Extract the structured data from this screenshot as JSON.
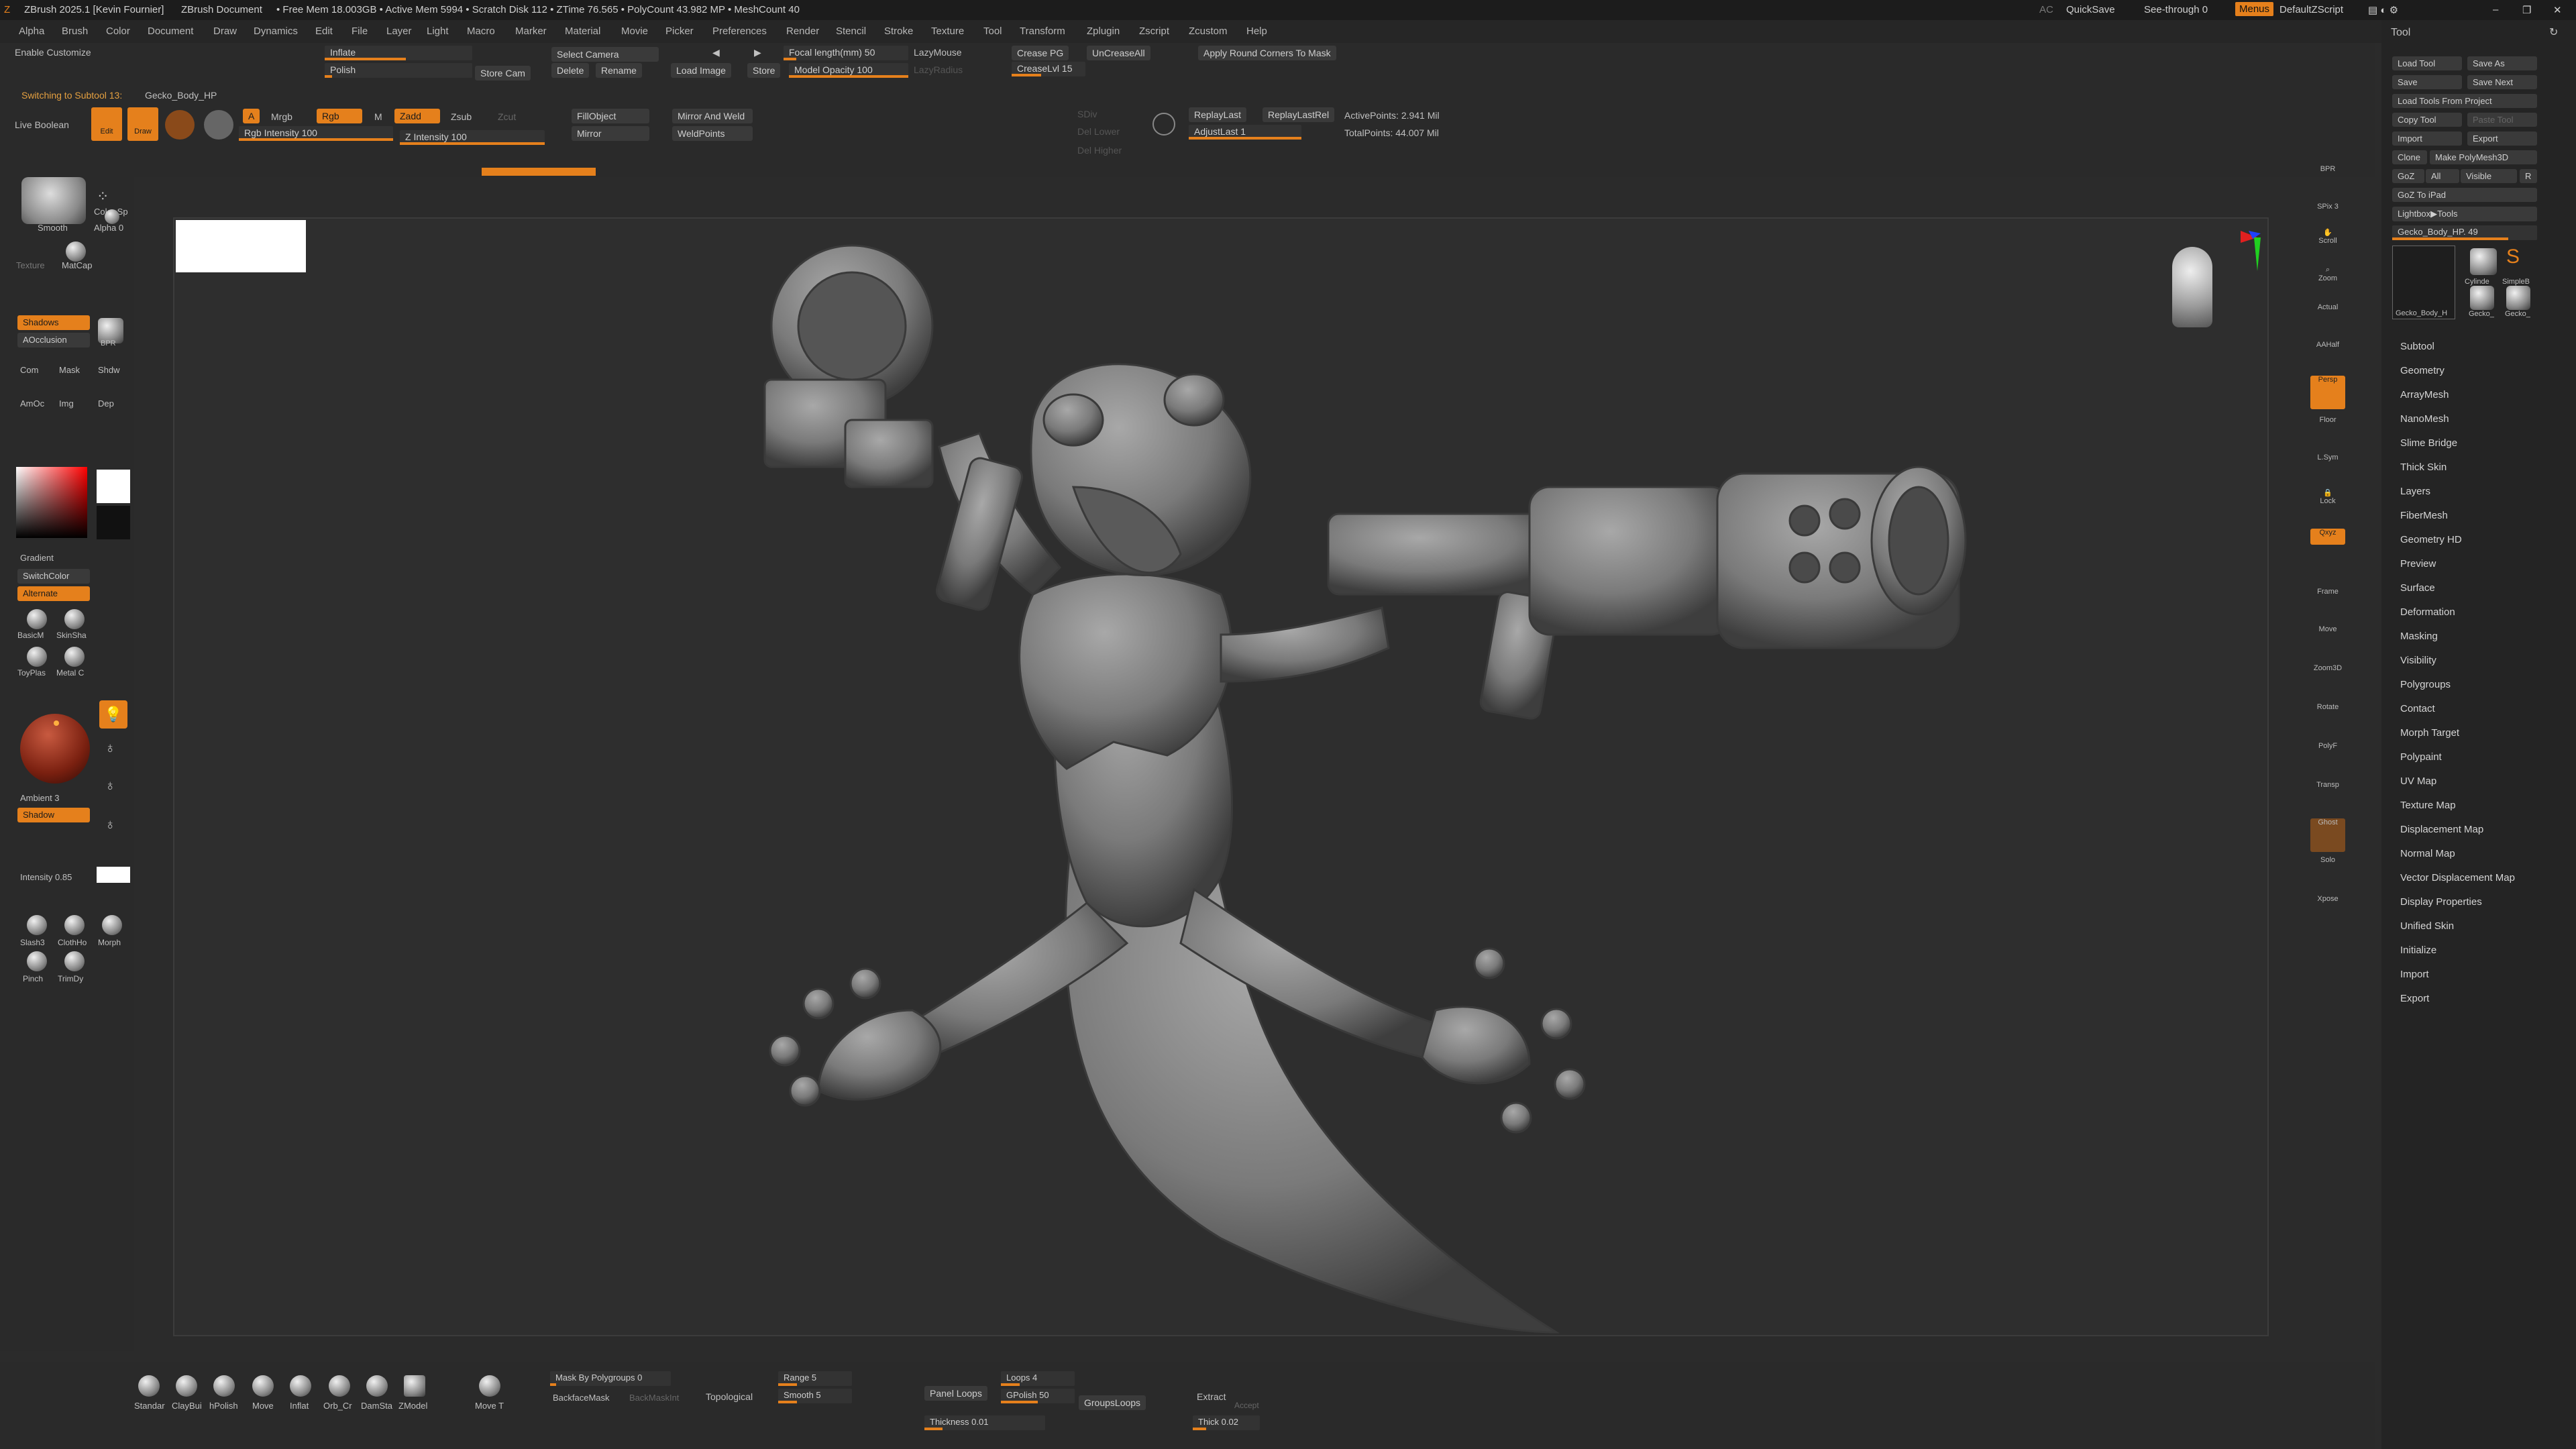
{
  "titlebar": {
    "app": "ZBrush 2025.1 [Kevin Fournier]",
    "doc": "ZBrush Document",
    "mem": "• Free Mem 18.003GB • Active Mem 5994 • Scratch Disk 112 • ZTime 76.565 • PolyCount 43.982 MP • MeshCount 40",
    "ac": "AC",
    "quicksave": "QuickSave",
    "seethrough": "See-through 0",
    "menus": "Menus",
    "script": "DefaultZScript"
  },
  "menu": [
    "Alpha",
    "Brush",
    "Color",
    "Document",
    "Draw",
    "Dynamics",
    "Edit",
    "File",
    "Layer",
    "Light",
    "Macro",
    "Marker",
    "Material",
    "Movie",
    "Picker",
    "Preferences",
    "Render",
    "Stencil",
    "Stroke",
    "Texture",
    "Tool",
    "Transform",
    "Zplugin",
    "Zscript",
    "Zcustom",
    "Help"
  ],
  "top": {
    "enable_customize": "Enable Customize",
    "switching": "Switching to Subtool 13:",
    "subtool_name": "Gecko_Body_HP",
    "live_boolean": "Live Boolean",
    "edit": "Edit",
    "draw": "Draw",
    "a": "A",
    "mrgb": "Mrgb",
    "rgb": "Rgb",
    "m": "M",
    "zadd": "Zadd",
    "zsub": "Zsub",
    "zcut": "Zcut",
    "rgb_intensity": "Rgb Intensity 100",
    "z_intensity": "Z Intensity 100",
    "inflate": "Inflate",
    "polish": "Polish",
    "store_cam": "Store Cam",
    "select_camera": "Select Camera",
    "delete": "Delete",
    "rename": "Rename",
    "load_image": "Load Image",
    "store": "Store",
    "focal": "Focal length(mm) 50",
    "model_opacity": "Model Opacity 100",
    "lazymouse": "LazyMouse",
    "lazyradius": "LazyRadius",
    "crease_pg": "Crease PG",
    "uncrease_all": "UnCreaseAll",
    "crease_lvl": "CreaseLvl 15",
    "apply_round": "Apply Round Corners To Mask",
    "fillobject": "FillObject",
    "mirror": "Mirror",
    "mirror_weld": "Mirror And Weld",
    "weldpoints": "WeldPoints",
    "del_lower": "Del Lower",
    "del_higher": "Del Higher",
    "sdiv": "SDiv",
    "replay_last": "ReplayLast",
    "replay_last_rel": "ReplayLastRel",
    "adjust_last": "AdjustLast 1",
    "active_points": "ActivePoints: 2.941 Mil",
    "total_points": "TotalPoints: 44.007 Mil"
  },
  "left": {
    "smooth": "Smooth",
    "color_spray": "Color Sp",
    "alpha_off": "Alpha 0",
    "texture": "Texture",
    "matcap": "MatCap",
    "shadows": "Shadows",
    "aocclusion": "AOcclusion",
    "bpr": "BPR",
    "com": "Com",
    "mask": "Mask",
    "shdw": "Shdw",
    "amoc": "AmOc",
    "img": "Img",
    "dep": "Dep",
    "gradient": "Gradient",
    "switchcolor": "SwitchColor",
    "alternate": "Alternate",
    "mat1": "BasicM",
    "mat2": "SkinSha",
    "mat3": "ToyPlas",
    "mat4": "Metal C",
    "ambient": "Ambient 3",
    "shadow": "Shadow",
    "intensity": "Intensity 0.85",
    "b1": "Slash3",
    "b2": "ClothHo",
    "b3": "Morph",
    "b4": "Pinch",
    "b5": "TrimDy"
  },
  "shelf": [
    "BPR",
    "SPix 3",
    "Scroll",
    "Zoom",
    "Actual",
    "AAHalf",
    "Persp",
    "Floor",
    "L.Sym",
    "Lock",
    "Qxyz",
    "Frame",
    "Move",
    "Zoom3D",
    "Rotate",
    "PolyF",
    "Transp",
    "Ghost",
    "Solo",
    "Xpose"
  ],
  "tool": {
    "title": "Tool",
    "load_tool": "Load Tool",
    "save_as": "Save As",
    "save": "Save",
    "save_next": "Save Next",
    "load_from_project": "Load Tools From Project",
    "copy_tool": "Copy Tool",
    "paste_tool": "Paste Tool",
    "import": "Import",
    "export": "Export",
    "clone": "Clone",
    "make_polymesh": "Make PolyMesh3D",
    "goz": "GoZ",
    "all": "All",
    "visible": "Visible",
    "r": "R",
    "goz_ipad": "GoZ To iPad",
    "lightbox_tools": "Lightbox▶Tools",
    "current": "Gecko_Body_HP. 49",
    "thumbs": [
      "Gecko_Body_H",
      "Cylinde",
      "SimpleB",
      "Gecko_",
      "Gecko_"
    ],
    "items": [
      "Subtool",
      "Geometry",
      "ArrayMesh",
      "NanoMesh",
      "Slime Bridge",
      "Thick Skin",
      "Layers",
      "FiberMesh",
      "Geometry HD",
      "Preview",
      "Surface",
      "Deformation",
      "Masking",
      "Visibility",
      "Polygroups",
      "Contact",
      "Morph Target",
      "Polypaint",
      "UV Map",
      "Texture Map",
      "Displacement Map",
      "Normal Map",
      "Vector Displacement Map",
      "Display Properties",
      "Unified Skin",
      "Initialize",
      "Import",
      "Export"
    ]
  },
  "bottom": {
    "brushes": [
      "Standar",
      "ClayBui",
      "hPolish",
      "Move",
      "Inflat",
      "Orb_Cr",
      "DamSta",
      "ZModel"
    ],
    "move_t": "Move T",
    "mask_by_pg": "Mask By Polygroups 0",
    "backface": "BackfaceMask",
    "backmask": "BackMaskInt",
    "topological": "Topological",
    "range": "Range 5",
    "smooth5": "Smooth 5",
    "panel_loops": "Panel Loops",
    "loops": "Loops 4",
    "gpolish": "GPolish 50",
    "groupsloops": "GroupsLoops",
    "thickness": "Thickness 0.01",
    "extract": "Extract",
    "accept": "Accept",
    "thick": "Thick 0.02"
  }
}
